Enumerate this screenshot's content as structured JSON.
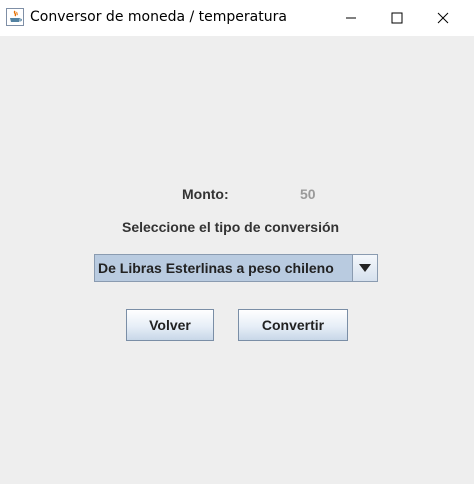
{
  "window": {
    "title": "Conversor de moneda / temperatura",
    "app_icon": "java-icon",
    "controls": {
      "minimize": "minimize-icon",
      "maximize": "maximize-icon",
      "close": "close-icon"
    }
  },
  "form": {
    "amount_label": "Monto:",
    "amount_value": "50",
    "select_prompt": "Seleccione el tipo de conversión",
    "conversion_selected": "De Libras Esterlinas a peso chileno",
    "back_button": "Volver",
    "convert_button": "Convertir"
  },
  "colors": {
    "background": "#eeeeee",
    "combo_selected": "#b9cbe0",
    "amount_value": "#9a9a9a"
  }
}
